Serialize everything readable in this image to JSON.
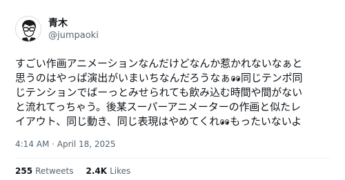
{
  "author": {
    "display_name": "青木",
    "handle": "@jumpaoki"
  },
  "tweet": {
    "lines": [
      [
        "すごい作画アニメーションなんだけどなんか惹かれないなぁと"
      ],
      [
        "思うのはやっぱ演出がいまいちなんだろうなぁ",
        "同じテンポ同"
      ],
      [
        "じテンションでばーっとみせられても飲み込む時間や間がない"
      ],
      [
        "と流れてっちゃう。後某スーパーアニメーターの作画と似たレ"
      ],
      [
        "イアウト、同じ動き、同じ表現はやめてくれ",
        "もったいないよ"
      ]
    ]
  },
  "meta": {
    "timestamp": "4:14 AM · April 18, 2025"
  },
  "stats": {
    "retweets_count": "255",
    "retweets_label": "Retweets",
    "likes_count": "2.4K",
    "likes_label": "Likes"
  },
  "icons": {
    "eyes": "eyes-emoji-icon"
  },
  "colors": {
    "text": "#0f1419",
    "secondary": "#536471",
    "divider": "#eff3f4"
  }
}
